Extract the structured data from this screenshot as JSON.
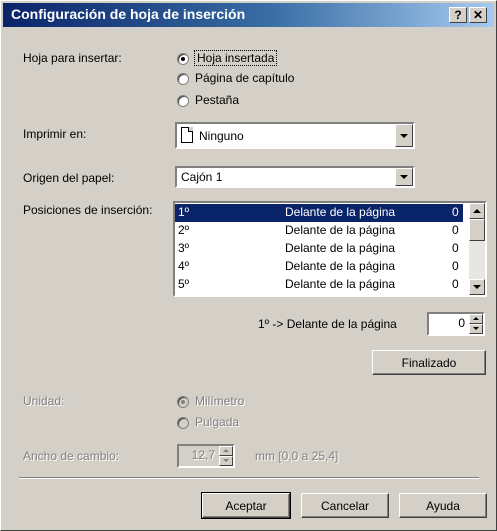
{
  "window": {
    "title": "Configuración de hoja de inserción",
    "help_button": "?",
    "close_button": "✕"
  },
  "sheet": {
    "label": "Hoja para insertar:",
    "options": [
      {
        "label": "Hoja insertada",
        "selected": true
      },
      {
        "label": "Página de capítulo",
        "selected": false
      },
      {
        "label": "Pestaña",
        "selected": false
      }
    ]
  },
  "print_on": {
    "label": "Imprimir en:",
    "value": "Ninguno",
    "icon": "blank-page-icon"
  },
  "paper_source": {
    "label": "Origen del papel:",
    "value": "Cajón 1"
  },
  "positions": {
    "label": "Posiciones de inserción:",
    "rows": [
      {
        "index": "1º",
        "position": "Delante de la página",
        "page": "0"
      },
      {
        "index": "2º",
        "position": "Delante de la página",
        "page": "0"
      },
      {
        "index": "3º",
        "position": "Delante de la página",
        "page": "0"
      },
      {
        "index": "4º",
        "position": "Delante de la página",
        "page": "0"
      },
      {
        "index": "5º",
        "position": "Delante de la página",
        "page": "0"
      }
    ],
    "selected_row": 0
  },
  "current_position": {
    "label_prefix": "1º -> ",
    "label_text": "Delante de la página",
    "page_value": "0"
  },
  "finalize_button": "Finalizado",
  "units": {
    "label": "Unidad:",
    "options": [
      {
        "label": "Milímetro",
        "selected": true
      },
      {
        "label": "Pulgada",
        "selected": false
      }
    ]
  },
  "shift_width": {
    "label": "Ancho de cambio:",
    "value": "12,7",
    "range": "mm [0,0 a 25,4]"
  },
  "footer": {
    "ok": "Aceptar",
    "cancel": "Cancelar",
    "help": "Ayuda"
  },
  "colors": {
    "title_bar_start": "#0a246a",
    "title_bar_end": "#a6caf0",
    "dialog_face": "#d4d0c8",
    "selection": "#0a246a"
  }
}
